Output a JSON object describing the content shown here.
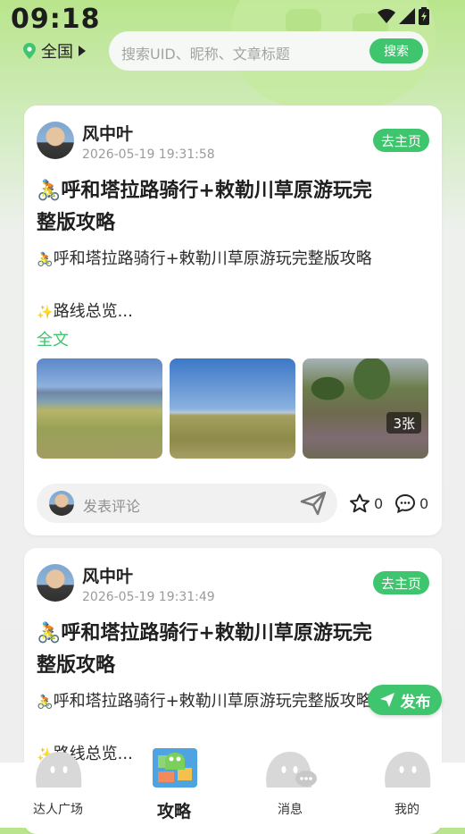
{
  "status_bar": {
    "time": "09:18"
  },
  "header": {
    "region": "全国",
    "search": {
      "placeholder": "搜索UID、昵称、文章标题",
      "button_label": "搜索"
    }
  },
  "posts": [
    {
      "author": "风中叶",
      "time": "2026-05-19 19:31:58",
      "home_label": "去主页",
      "title_line1": "呼和塔拉路骑行+敕勒川草原游玩完",
      "title_line2": "整版攻略",
      "excerpt_line1": "呼和塔拉路骑行+敕勒川草原游玩完整版攻略",
      "excerpt_line2": "路线总览...",
      "full_text_label": "全文",
      "photo_count": "3张",
      "comment_placeholder": "发表评论",
      "likes": "0",
      "comments": "0"
    },
    {
      "author": "风中叶",
      "time": "2026-05-19 19:31:49",
      "home_label": "去主页",
      "title_line1": "呼和塔拉路骑行+敕勒川草原游玩完",
      "title_line2": "整版攻略",
      "excerpt_line1": "呼和塔拉路骑行+敕勒川草原游玩完整版攻略",
      "excerpt_line2": "路线总览..."
    }
  ],
  "publish_label": "发布",
  "tabbar": {
    "items": [
      {
        "label": "达人广场",
        "icon": "ghost-mascot-icon"
      },
      {
        "label": "攻略",
        "icon": "map-mascot-icon",
        "active": true
      },
      {
        "label": "消息",
        "icon": "message-mascot-icon"
      },
      {
        "label": "我的",
        "icon": "profile-mascot-icon"
      }
    ]
  },
  "colors": {
    "accent": "#3fc56d",
    "card": "#ffffff"
  }
}
